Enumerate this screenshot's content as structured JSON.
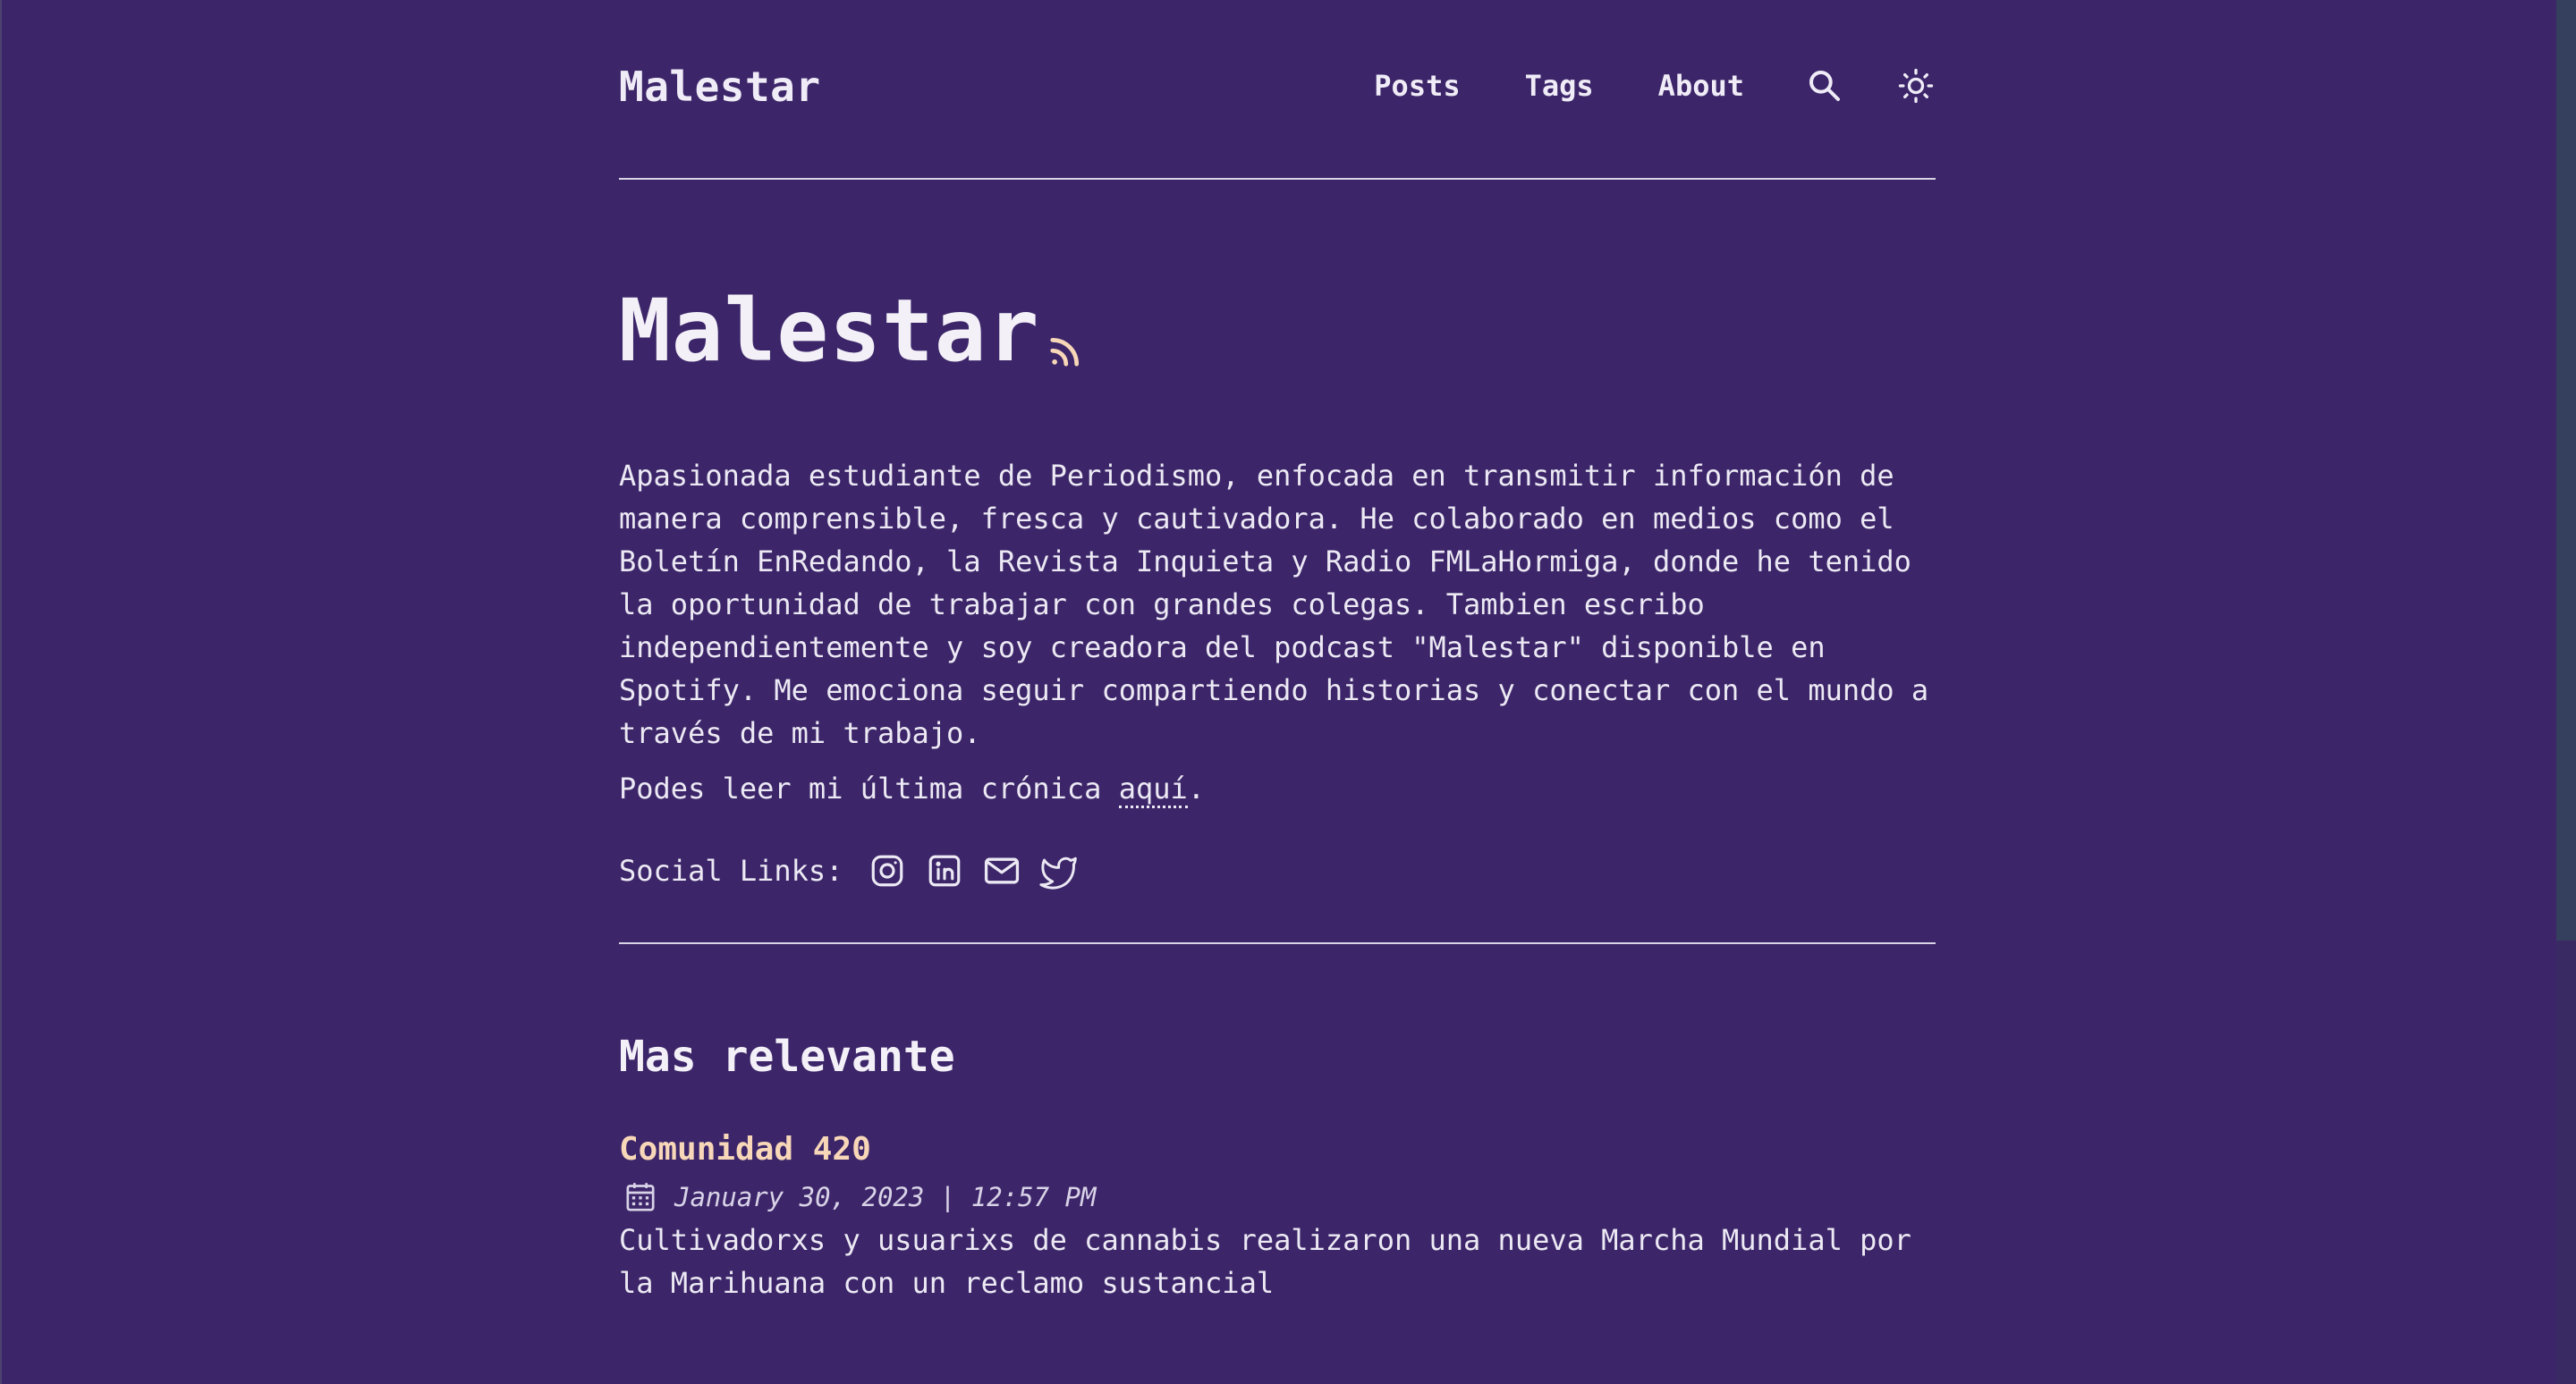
{
  "header": {
    "logo": "Malestar",
    "nav": {
      "posts": "Posts",
      "tags": "Tags",
      "about": "About"
    },
    "icons": {
      "search": "search-icon",
      "theme": "sun-icon"
    }
  },
  "hero": {
    "title": "Malestar",
    "rss_icon": "rss-icon",
    "bio": "Apasionada estudiante de Periodismo, enfocada en transmitir información de manera comprensible, fresca y cautivadora. He colaborado en medios como el Boletín EnRedando, la Revista Inquieta y Radio FMLaHormiga, donde he tenido la oportunidad de trabajar con grandes colegas. Tambien escribo independientemente y soy creadora del podcast \"Malestar\" disponible en Spotify. Me emociona seguir compartiendo historias y conectar con el mundo a través de mi trabajo.",
    "latest_prefix": "Podes leer mi última crónica ",
    "latest_link": "aquí",
    "latest_suffix": ".",
    "social_label": "Social Links:",
    "social_icons": [
      "instagram-icon",
      "linkedin-icon",
      "mail-icon",
      "twitter-icon"
    ]
  },
  "section": {
    "title": "Mas relevante"
  },
  "posts": [
    {
      "title": "Comunidad 420",
      "date": "January 30, 2023 | 12:57 PM",
      "description": "Cultivadorxs y usuarixs de cannabis realizaron una nueva Marcha Mundial por la Marihuana con un reclamo sustancial"
    }
  ],
  "colors": {
    "background": "#3c2669",
    "text": "#ece9f4",
    "accent": "#f7d7b8"
  }
}
